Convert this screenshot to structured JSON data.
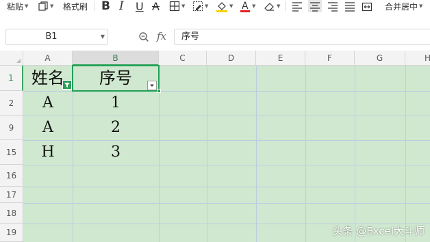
{
  "toolbar": {
    "paste_label": "粘贴",
    "format_painter_label": "格式刷",
    "merge_center_label": "合并居中"
  },
  "formula_bar": {
    "name_box": "B1",
    "fx_label": "fx",
    "formula": "序号"
  },
  "columns": [
    "A",
    "B",
    "C",
    "D",
    "E",
    "F",
    "G",
    "H"
  ],
  "rows": [
    "1",
    "2",
    "9",
    "15",
    "16",
    "17",
    "18",
    "19"
  ],
  "selected_cell": "B1",
  "table": {
    "headers": [
      "姓名",
      "序号"
    ],
    "data": [
      [
        "A",
        "1"
      ],
      [
        "A",
        "2"
      ],
      [
        "H",
        "3"
      ]
    ]
  },
  "colors": {
    "sheet_fill": "#cfe8cf",
    "selection": "#22a05a",
    "filter_active": "#2e9e5a"
  },
  "watermark": "头条 @Excel大斗师"
}
